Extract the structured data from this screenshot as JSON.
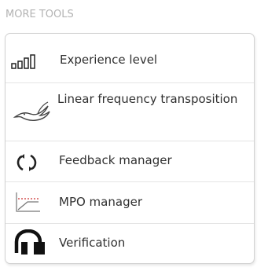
{
  "section": {
    "title": "MORE TOOLS"
  },
  "menu": {
    "items": [
      {
        "label": "Experience level",
        "icon": "signal-bars-icon"
      },
      {
        "label": "Linear frequency transposition",
        "icon": "bird-icon"
      },
      {
        "label": "Feedback manager",
        "icon": "refresh-arrows-icon"
      },
      {
        "label": "MPO manager",
        "icon": "mpo-graph-icon"
      },
      {
        "label": "Verification",
        "icon": "headset-icon"
      }
    ]
  },
  "colors": {
    "title": "#b3b3b3",
    "label": "#303030",
    "border": "#d2d2d2",
    "divider": "#e4e4e4",
    "icon_dark": "#222222",
    "mpo_red": "#cc3333"
  }
}
